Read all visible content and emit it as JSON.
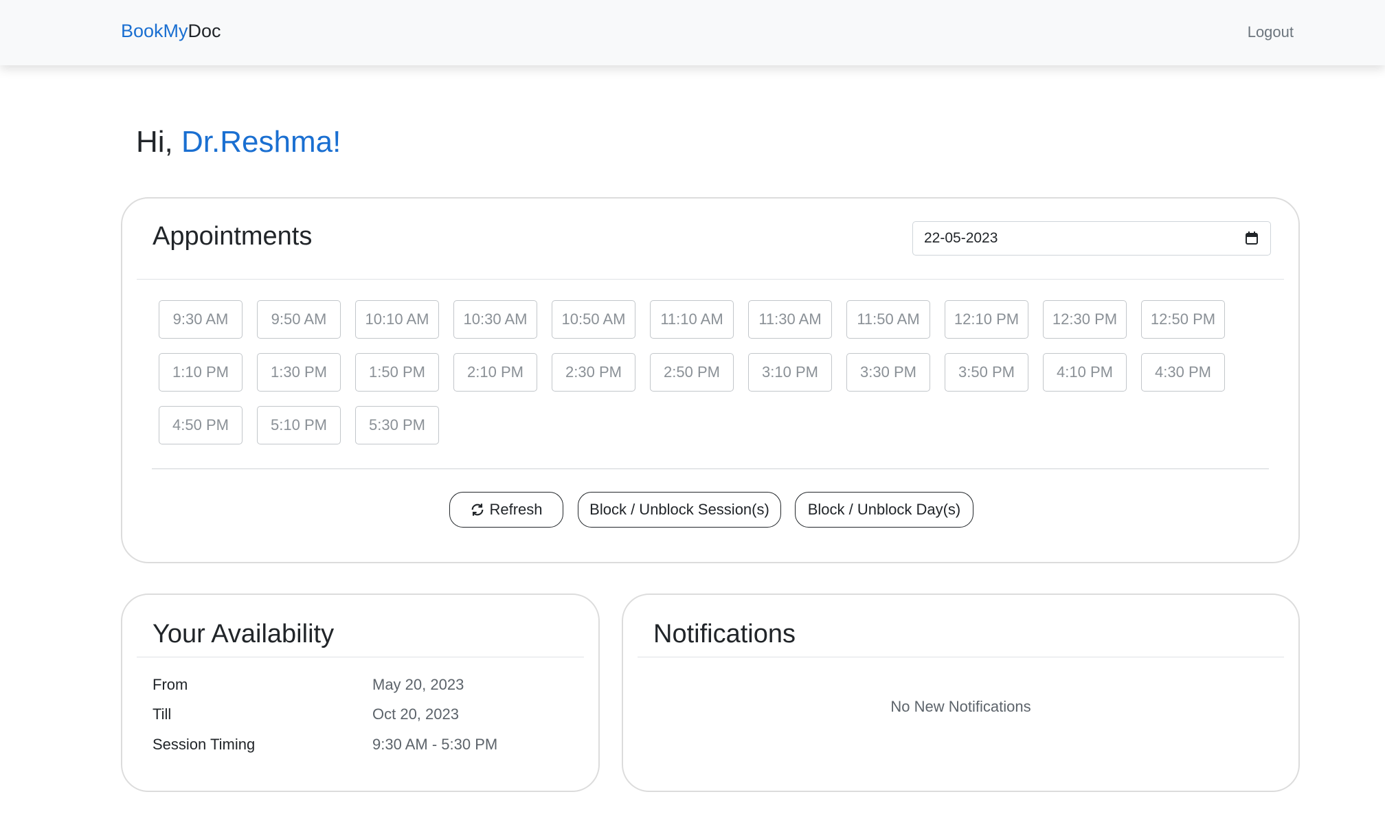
{
  "nav": {
    "brand_part1": "BookMy",
    "brand_part2": "Doc",
    "logout_label": "Logout"
  },
  "greeting": {
    "prefix": "Hi,",
    "name": "Dr.Reshma!"
  },
  "appointments": {
    "title": "Appointments",
    "date_value": "22-05-2023",
    "slots": [
      "9:30 AM",
      "9:50 AM",
      "10:10 AM",
      "10:30 AM",
      "10:50 AM",
      "11:10 AM",
      "11:30 AM",
      "11:50 AM",
      "12:10 PM",
      "12:30 PM",
      "12:50 PM",
      "1:10 PM",
      "1:30 PM",
      "1:50 PM",
      "2:10 PM",
      "2:30 PM",
      "2:50 PM",
      "3:10 PM",
      "3:30 PM",
      "3:50 PM",
      "4:10 PM",
      "4:30 PM",
      "4:50 PM",
      "5:10 PM",
      "5:30 PM"
    ],
    "refresh_label": "Refresh",
    "block_session_label": "Block / Unblock Session(s)",
    "block_day_label": "Block / Unblock Day(s)"
  },
  "availability": {
    "title": "Your Availability",
    "rows": [
      {
        "label": "From",
        "value": "May 20, 2023"
      },
      {
        "label": "Till",
        "value": "Oct 20, 2023"
      },
      {
        "label": "Session Timing",
        "value": "9:30 AM - 5:30 PM"
      }
    ]
  },
  "notifications": {
    "title": "Notifications",
    "empty_text": "No New Notifications"
  },
  "colors": {
    "accent": "#1a6fd1",
    "nav_bg": "#f8f9fa"
  }
}
